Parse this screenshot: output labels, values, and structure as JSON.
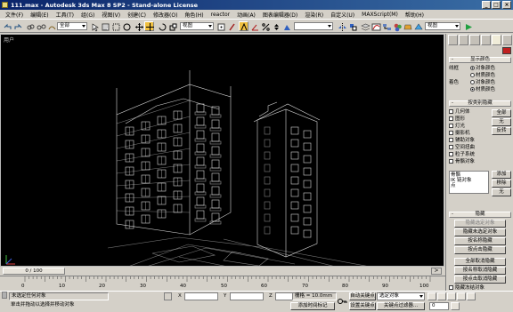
{
  "window": {
    "title": "111.max - Autodesk 3ds Max 8 SP2 - Stand-alone License",
    "min": "_",
    "max": "□",
    "close": "×"
  },
  "menu": [
    "文件(F)",
    "编辑(E)",
    "工具(T)",
    "组(G)",
    "视图(V)",
    "创建(C)",
    "修改器(O)",
    "角色(H)",
    "reactor",
    "动画(A)",
    "图表编辑器(D)",
    "渲染(R)",
    "自定义(U)",
    "MAXScript(M)",
    "帮助(H)"
  ],
  "toolbar": {
    "selection_filter": "全部",
    "reference_coord": "视图",
    "named_selection": "",
    "view_dropdown": "视图"
  },
  "viewport": {
    "label": "用户"
  },
  "panel": {
    "display_color": {
      "header": "显示颜色",
      "wireframe_label": "线框",
      "shaded_label": "着色",
      "options_wire": [
        "对象颜色",
        "材质颜色"
      ],
      "options_shaded": [
        "对象颜色",
        "材质颜色"
      ],
      "wire_selected": 0,
      "shaded_selected": 1
    },
    "hide_by_category": {
      "header": "按类别隐藏",
      "items": [
        "几何体",
        "图形",
        "灯光",
        "摄影机",
        "辅助对象",
        "空间扭曲",
        "粒子系统",
        "骨骼对象"
      ],
      "buttons": [
        "全部",
        "无",
        "反转"
      ],
      "list": [
        "骨骼",
        "IK 链对象",
        "点"
      ],
      "add": "添加",
      "remove": "移除",
      "none": "无"
    },
    "hide": {
      "header": "隐藏",
      "buttons": [
        "隐藏选定对象",
        "隐藏未选定对象",
        "按名称隐藏",
        "按点击隐藏",
        "全部取消隐藏",
        "按名称取消隐藏",
        "按点击取消隐藏"
      ],
      "hide_frozen": "隐藏冻结对象"
    }
  },
  "timeline": {
    "frame_label": "0 / 100",
    "ticks": [
      "0",
      "10",
      "20",
      "30",
      "40",
      "50",
      "60",
      "70",
      "80",
      "90",
      "100"
    ]
  },
  "status": {
    "selection": "未选定任何对象",
    "prompt": "单击并拖动以选择并移动对象",
    "x_label": "X",
    "y_label": "Y",
    "z_label": "Z",
    "grid": "栅格 = 10.0mm",
    "add_time_tag": "添加时间标记",
    "auto_key": "自动关键点",
    "set_key": "设置关键点",
    "selected_object": "选定对象",
    "key_filters": "关键点过滤器...",
    "frame": "0"
  }
}
